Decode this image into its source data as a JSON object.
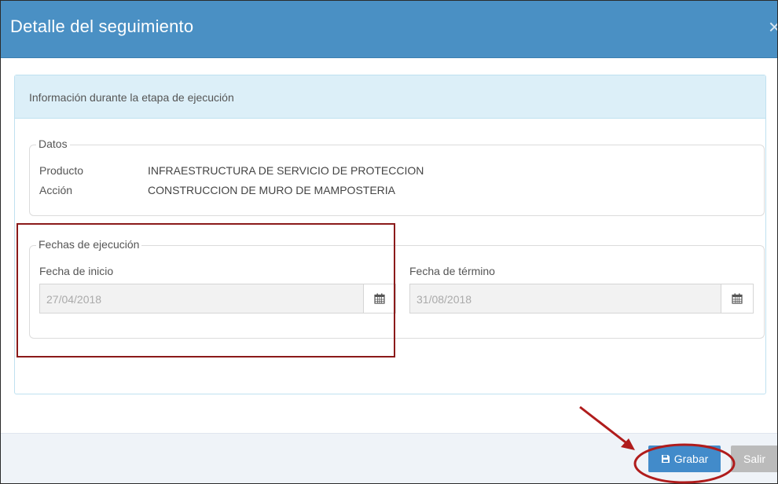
{
  "modal": {
    "title": "Detalle del seguimiento",
    "close_label": "×"
  },
  "panel": {
    "heading": "Información durante la etapa de ejecución"
  },
  "datos": {
    "legend": "Datos",
    "rows": [
      {
        "label": "Producto",
        "value": "INFRAESTRUCTURA DE SERVICIO DE PROTECCION"
      },
      {
        "label": "Acción",
        "value": "CONSTRUCCION DE MURO DE MAMPOSTERIA"
      }
    ]
  },
  "fechas": {
    "legend": "Fechas de ejecución",
    "inicio_label": "Fecha de inicio",
    "inicio_value": "27/04/2018",
    "termino_label": "Fecha de término",
    "termino_value": "31/08/2018",
    "calendar_icon": "calendar-icon"
  },
  "footer": {
    "save_label": "Grabar",
    "save_icon": "save-icon",
    "exit_label": "Salir"
  },
  "annotations": {
    "color": "#b01c1c"
  }
}
